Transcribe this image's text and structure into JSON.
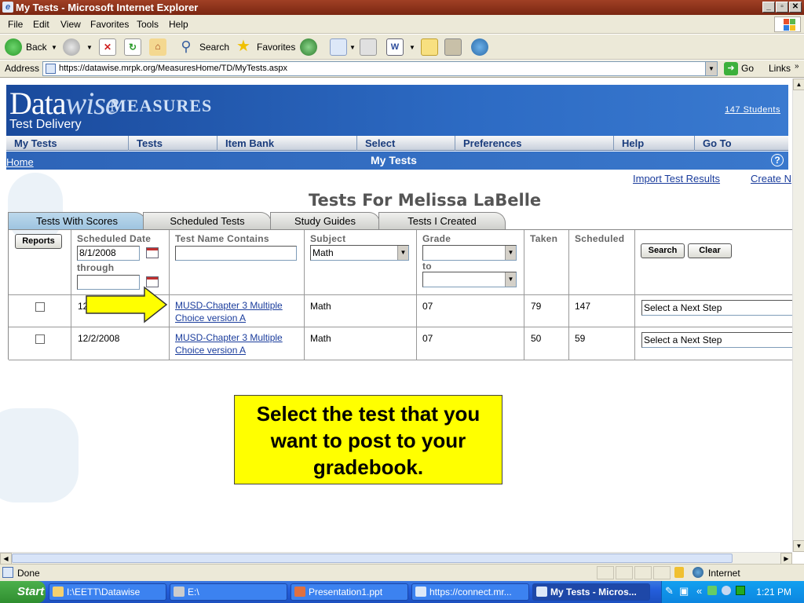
{
  "window": {
    "title": "My Tests - Microsoft Internet Explorer"
  },
  "menu": [
    "File",
    "Edit",
    "View",
    "Favorites",
    "Tools",
    "Help"
  ],
  "toolbar": {
    "back": "Back",
    "search": "Search",
    "favorites": "Favorites"
  },
  "address": {
    "label": "Address",
    "url": "https://datawise.mrpk.org/MeasuresHome/TD/MyTests.aspx",
    "go": "Go",
    "links": "Links"
  },
  "banner": {
    "logo_data": "Data",
    "logo_wise": "wise",
    "logo_measures": "MEASURES",
    "subtitle": "Test Delivery",
    "students": "147 Students"
  },
  "nav": [
    "My Tests",
    "Tests",
    "Item Bank",
    "Select",
    "Preferences",
    "Help",
    "Go To"
  ],
  "subnav": {
    "home": "Home",
    "title": "My Tests",
    "help": "?"
  },
  "links": {
    "import": "Import Test Results",
    "create": "Create N"
  },
  "heading": "Tests For Melissa LaBelle",
  "tabs": [
    "Tests With Scores",
    "Scheduled Tests",
    "Study Guides",
    "Tests I Created"
  ],
  "filters": {
    "reports": "Reports",
    "scheduled_date": "Scheduled Date",
    "date_from": "8/1/2008",
    "through": "through",
    "test_name": "Test Name Contains",
    "subject": "Subject",
    "subject_value": "Math",
    "grade": "Grade",
    "to": "to",
    "taken": "Taken",
    "scheduled": "Scheduled",
    "search": "Search",
    "clear": "Clear"
  },
  "rows": [
    {
      "date": "12",
      "name_line1": "MUSD-Chapter 3 Multiple",
      "name_line2": "Choice version A",
      "subject": "Math",
      "grade": "07",
      "taken": "79",
      "scheduled": "147",
      "next": "Select a Next Step"
    },
    {
      "date": "12/2/2008",
      "name_line1": "MUSD-Chapter 3 Multiple",
      "name_line2": "Choice version A",
      "subject": "Math",
      "grade": "07",
      "taken": "50",
      "scheduled": "59",
      "next": "Select a Next Step"
    }
  ],
  "callout": {
    "line1": "Select the test that you",
    "line2": "want to post to your",
    "line3": "gradebook."
  },
  "status": {
    "text": "Done",
    "zone": "Internet"
  },
  "taskbar": {
    "start": "Start",
    "items": [
      "I:\\EETT\\Datawise",
      "E:\\",
      "Presentation1.ppt",
      "https://connect.mr...",
      "My Tests - Micros..."
    ],
    "clock": "1:21 PM"
  },
  "colors": {
    "banner": "#2d64b8",
    "callout": "#ffff00",
    "link": "#1a3c9c",
    "titlebar": "#a04025"
  }
}
